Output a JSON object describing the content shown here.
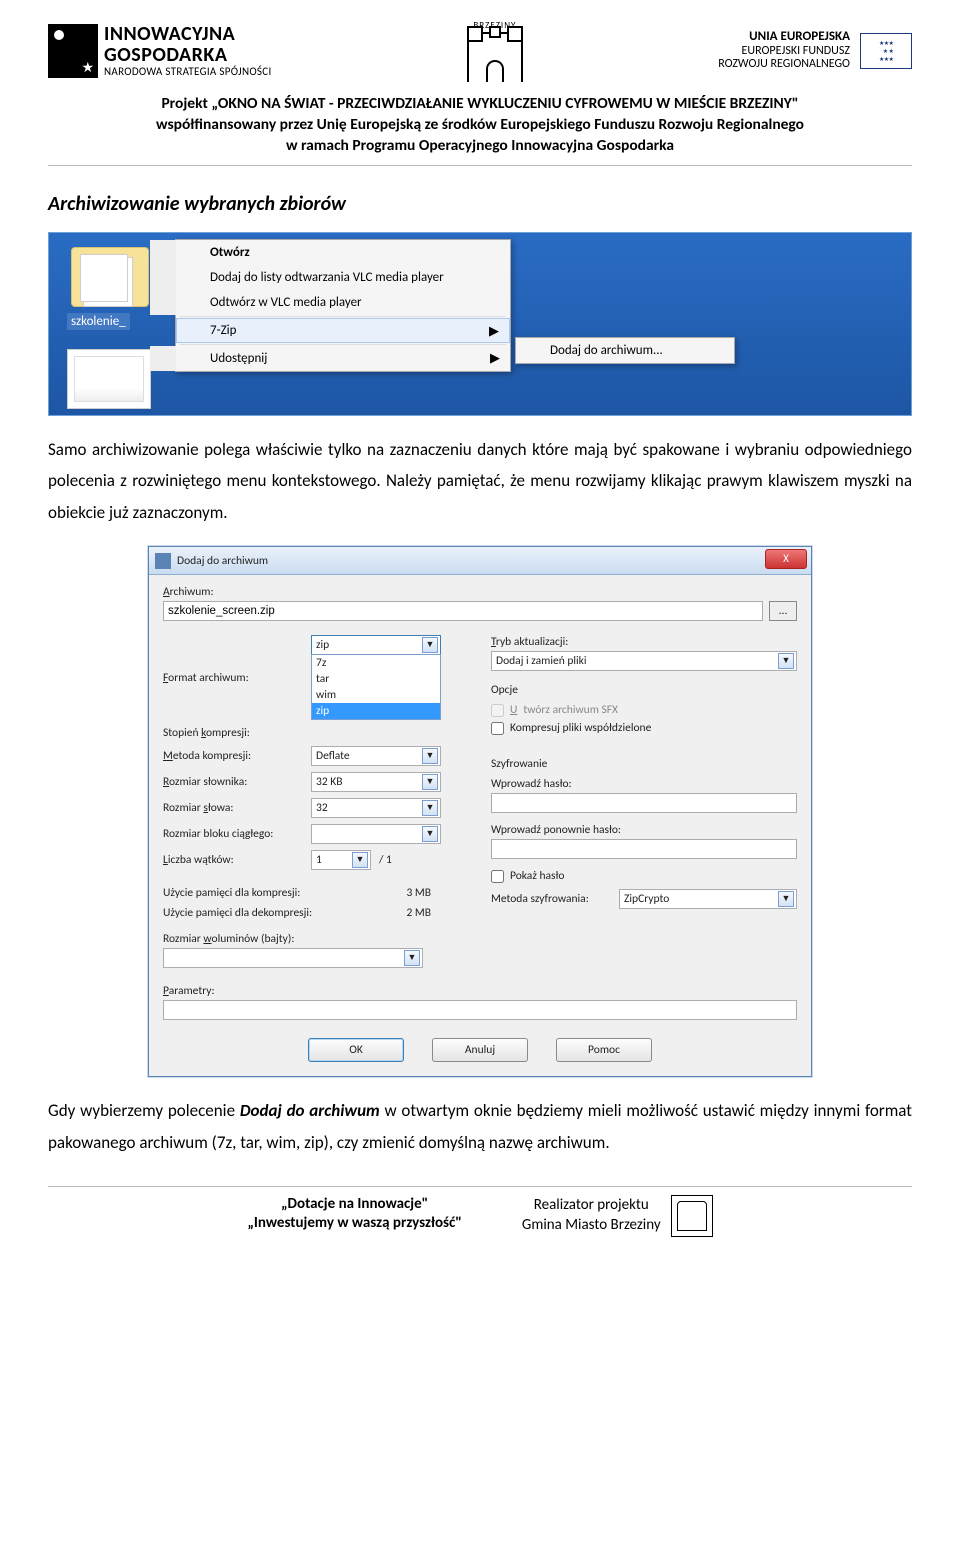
{
  "header": {
    "ig_line1": "INNOWACYJNA",
    "ig_line2": "GOSPODARKA",
    "ig_line3": "NARODOWA STRATEGIA SPÓJNOŚCI",
    "brzeziny": "BRZEZINY",
    "eu_line1": "UNIA EUROPEJSKA",
    "eu_line2": "EUROPEJSKI FUNDUSZ",
    "eu_line3": "ROZWOJU REGIONALNEGO",
    "eu_stars": "★ ★ ★ ★ ★"
  },
  "project": {
    "l1a": "Projekt „OKNO NA ŚWIAT - PRZECIWDZIAŁANIE WYKLUCZENIU CYFROWEMU W MIEŚCIE BRZEZINY\"",
    "l2": "współfinansowany przez Unię Europejską ze środków Europejskiego Funduszu Rozwoju Regionalnego",
    "l3": "w ramach Programu Operacyjnego Innowacyjna Gospodarka"
  },
  "section_title": "Archiwizowanie wybranych zbiorów",
  "shot1": {
    "folder_label": "szkolenie_",
    "menu": {
      "open": "Otwórz",
      "vlc_add": "Dodaj do listy odtwarzania VLC media player",
      "vlc_play": "Odtwórz w VLC media player",
      "sevenzip": "7-Zip",
      "share": "Udostępnij",
      "arrow": "▶"
    },
    "submenu": {
      "add_archive": "Dodaj do archiwum..."
    }
  },
  "para1": "Samo archiwizowanie polega właściwie tylko na zaznaczeniu danych które mają być spakowane i wybraniu odpowiedniego polecenia z rozwiniętego menu kontekstowego. Należy pamiętać, że menu rozwijamy klikając prawym klawiszem myszki na obiekcie już zaznaczonym.",
  "shot2": {
    "title": "Dodaj do archiwum",
    "close": "X",
    "archive_lbl": "Archiwum:",
    "archive_val": "szkolenie_screen.zip",
    "browse": "...",
    "format_lbl": "Format archiwum:",
    "format_sel": "zip",
    "format_opts": [
      "7z",
      "tar",
      "wim",
      "zip"
    ],
    "level_lbl": "Stopień kompresji:",
    "method_lbl": "Metoda kompresji:",
    "method_val": "Deflate",
    "dict_lbl": "Rozmiar słownika:",
    "dict_val": "32 KB",
    "word_lbl": "Rozmiar słowa:",
    "word_val": "32",
    "block_lbl": "Rozmiar bloku ciągłego:",
    "threads_lbl": "Liczba wątków:",
    "threads_val": "1",
    "threads_max": "/ 1",
    "memc_lbl": "Użycie pamięci dla kompresji:",
    "memc_val": "3 MB",
    "memd_lbl": "Użycie pamięci dla dekompresji:",
    "memd_val": "2 MB",
    "vol_lbl": "Rozmiar woluminów (bajty):",
    "update_lbl": "Tryb aktualizacji:",
    "update_val": "Dodaj i zamień pliki",
    "opts_title": "Opcje",
    "sfx": "Utwórz archiwum SFX",
    "shared": "Kompresuj pliki współdzielone",
    "enc_title": "Szyfrowanie",
    "pw1": "Wprowadź hasło:",
    "pw2": "Wprowadź ponownie hasło:",
    "showpw": "Pokaż hasło",
    "encmethod_lbl": "Metoda szyfrowania:",
    "encmethod_val": "ZipCrypto",
    "params_lbl": "Parametry:",
    "ok": "OK",
    "cancel": "Anuluj",
    "help": "Pomoc",
    "dd": "▼"
  },
  "para2_a": "Gdy wybierzemy polecenie ",
  "para2_b": "Dodaj do archiwum",
  "para2_c": " w otwartym oknie będziemy mieli możliwość ustawić między innymi format pakowanego archiwum (7z, tar, wim, zip), czy zmienić domyślną nazwę archiwum.",
  "footer": {
    "c1a": "„Dotacje na Innowacje\"",
    "c1b": "„Inwestujemy w waszą przyszłość\"",
    "c2a": "Realizator projektu",
    "c2b": "Gmina Miasto Brzeziny"
  }
}
